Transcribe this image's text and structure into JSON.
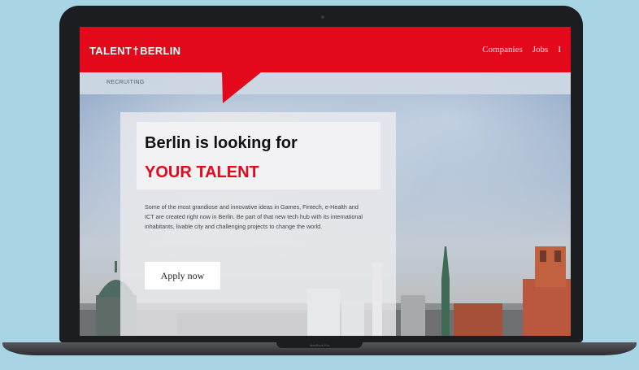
{
  "site": {
    "logo_left": "TALENT",
    "logo_right": "BERLIN",
    "logo_glyph": "tower-icon"
  },
  "nav": {
    "items": [
      "Companies",
      "Jobs",
      "I"
    ]
  },
  "subnav": {
    "label": "RECRUITING"
  },
  "hero": {
    "headline_line1": "Berlin is looking for",
    "headline_line2": "YOUR TALENT",
    "body": "Some of the most grandiose and innovative ideas in Games, Fintech, e-Health and ICT are created right now in Berlin. Be part of that new tech hub with its international inhabitants, livable city and challenging projects to change the world.",
    "cta_label": "Apply now"
  },
  "device": {
    "base_label": "MacBook Pro"
  },
  "colors": {
    "brand_red": "#e3081a",
    "background": "#a9d4e4",
    "laptop_frame": "#1c1d21"
  }
}
